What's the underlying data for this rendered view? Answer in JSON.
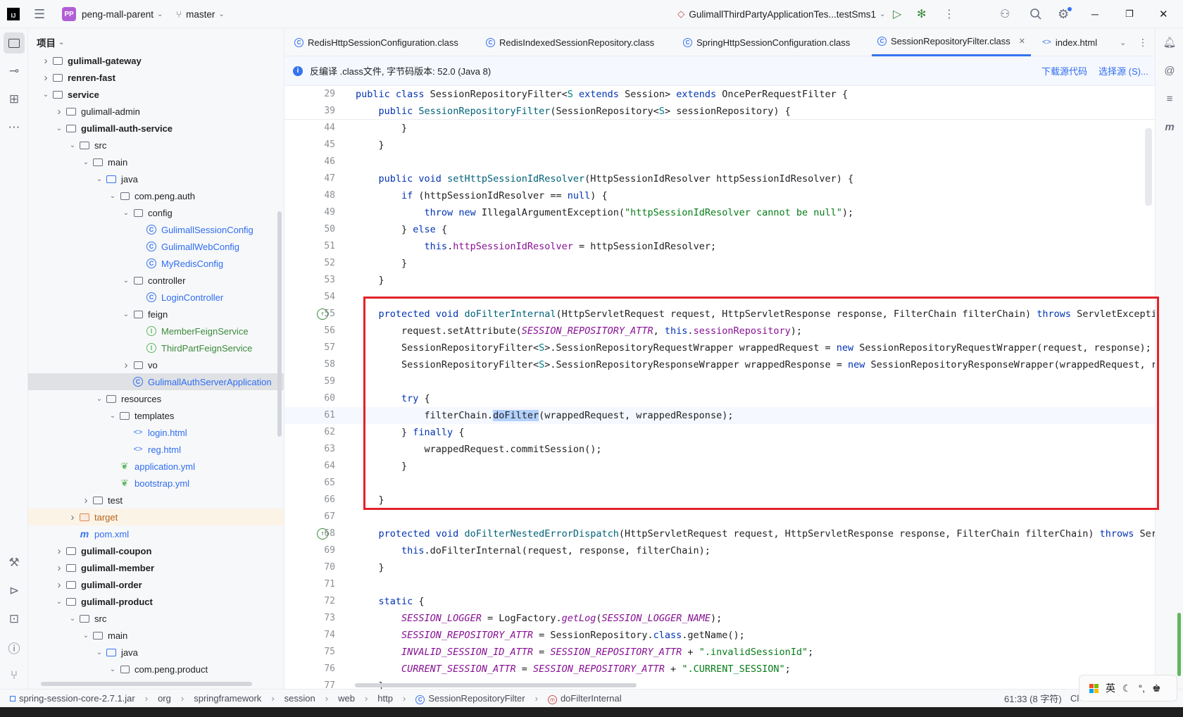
{
  "titlebar": {
    "project_badge": "PP",
    "project_name": "peng-mall-parent",
    "branch": "master",
    "run_config": "GulimallThirdPartyApplicationTes...testSms1"
  },
  "project_panel": {
    "title": "项目",
    "tree": [
      {
        "label": "gulimall-gateway",
        "indent": 1,
        "chev": "right",
        "icon": "module",
        "style": "bold"
      },
      {
        "label": "renren-fast",
        "indent": 1,
        "chev": "right",
        "icon": "module",
        "style": "bold"
      },
      {
        "label": "service",
        "indent": 1,
        "chev": "down",
        "icon": "module",
        "style": "bold"
      },
      {
        "label": "gulimall-admin",
        "indent": 2,
        "chev": "right",
        "icon": "module",
        "style": "normal"
      },
      {
        "label": "gulimall-auth-service",
        "indent": 2,
        "chev": "down",
        "icon": "module",
        "style": "bold"
      },
      {
        "label": "src",
        "indent": 3,
        "chev": "down",
        "icon": "folder",
        "style": "normal"
      },
      {
        "label": "main",
        "indent": 4,
        "chev": "down",
        "icon": "folder",
        "style": "normal"
      },
      {
        "label": "java",
        "indent": 5,
        "chev": "down",
        "icon": "folder-src",
        "style": "normal"
      },
      {
        "label": "com.peng.auth",
        "indent": 6,
        "chev": "down",
        "icon": "package",
        "style": "normal"
      },
      {
        "label": "config",
        "indent": 7,
        "chev": "down",
        "icon": "package",
        "style": "normal"
      },
      {
        "label": "GulimallSessionConfig",
        "indent": 8,
        "chev": "",
        "icon": "class",
        "style": "blue"
      },
      {
        "label": "GulimallWebConfig",
        "indent": 8,
        "chev": "",
        "icon": "class",
        "style": "blue"
      },
      {
        "label": "MyRedisConfig",
        "indent": 8,
        "chev": "",
        "icon": "class",
        "style": "blue"
      },
      {
        "label": "controller",
        "indent": 7,
        "chev": "down",
        "icon": "package",
        "style": "normal"
      },
      {
        "label": "LoginController",
        "indent": 8,
        "chev": "",
        "icon": "class",
        "style": "blue"
      },
      {
        "label": "feign",
        "indent": 7,
        "chev": "down",
        "icon": "package",
        "style": "normal"
      },
      {
        "label": "MemberFeignService",
        "indent": 8,
        "chev": "",
        "icon": "interface",
        "style": "green"
      },
      {
        "label": "ThirdPartFeignService",
        "indent": 8,
        "chev": "",
        "icon": "interface",
        "style": "green"
      },
      {
        "label": "vo",
        "indent": 7,
        "chev": "right",
        "icon": "package",
        "style": "normal"
      },
      {
        "label": "GulimallAuthServerApplication",
        "indent": 7,
        "chev": "",
        "icon": "class",
        "style": "blue",
        "selected": true
      },
      {
        "label": "resources",
        "indent": 5,
        "chev": "down",
        "icon": "folder",
        "style": "normal"
      },
      {
        "label": "templates",
        "indent": 6,
        "chev": "down",
        "icon": "folder",
        "style": "normal"
      },
      {
        "label": "login.html",
        "indent": 7,
        "chev": "",
        "icon": "html",
        "style": "blue"
      },
      {
        "label": "reg.html",
        "indent": 7,
        "chev": "",
        "icon": "html",
        "style": "blue"
      },
      {
        "label": "application.yml",
        "indent": 6,
        "chev": "",
        "icon": "yml",
        "style": "blue"
      },
      {
        "label": "bootstrap.yml",
        "indent": 6,
        "chev": "",
        "icon": "yml",
        "style": "blue"
      },
      {
        "label": "test",
        "indent": 4,
        "chev": "right",
        "icon": "folder",
        "style": "normal"
      },
      {
        "label": "target",
        "indent": 3,
        "chev": "right",
        "icon": "folder-orange",
        "style": "orange",
        "highlight": true
      },
      {
        "label": "pom.xml",
        "indent": 3,
        "chev": "",
        "icon": "maven",
        "style": "blue"
      },
      {
        "label": "gulimall-coupon",
        "indent": 2,
        "chev": "right",
        "icon": "module",
        "style": "bold"
      },
      {
        "label": "gulimall-member",
        "indent": 2,
        "chev": "right",
        "icon": "module",
        "style": "bold"
      },
      {
        "label": "gulimall-order",
        "indent": 2,
        "chev": "right",
        "icon": "module",
        "style": "bold"
      },
      {
        "label": "gulimall-product",
        "indent": 2,
        "chev": "down",
        "icon": "module",
        "style": "bold"
      },
      {
        "label": "src",
        "indent": 3,
        "chev": "down",
        "icon": "folder",
        "style": "normal"
      },
      {
        "label": "main",
        "indent": 4,
        "chev": "down",
        "icon": "folder",
        "style": "normal"
      },
      {
        "label": "java",
        "indent": 5,
        "chev": "down",
        "icon": "folder-src",
        "style": "normal"
      },
      {
        "label": "com.peng.product",
        "indent": 6,
        "chev": "down",
        "icon": "package",
        "style": "normal"
      }
    ]
  },
  "tabs": [
    {
      "label": "RedisHttpSessionConfiguration.class",
      "active": false
    },
    {
      "label": "RedisIndexedSessionRepository.class",
      "active": false
    },
    {
      "label": "SpringHttpSessionConfiguration.class",
      "active": false
    },
    {
      "label": "SessionRepositoryFilter.class",
      "active": true
    },
    {
      "label": "index.html",
      "active": false
    }
  ],
  "banner": {
    "text": "反编译 .class文件, 字节码版本: 52.0 (Java 8)",
    "download_link": "下载源代码",
    "choose_link": "选择源 (S)..."
  },
  "sticky_lines": [
    {
      "no": "29",
      "code": [
        [
          "kw",
          "public class "
        ],
        [
          "",
          "SessionRepositoryFilter<"
        ],
        [
          "tp",
          "S"
        ],
        [
          "",
          " "
        ],
        [
          "kw",
          "extends "
        ],
        [
          "",
          "Session> "
        ],
        [
          "kw",
          "extends "
        ],
        [
          "",
          "OncePerRequestFilter {"
        ]
      ]
    },
    {
      "no": "39",
      "code": [
        [
          "",
          "    "
        ],
        [
          "kw",
          "public "
        ],
        [
          "fn",
          "SessionRepositoryFilter"
        ],
        [
          "",
          "(SessionRepository<"
        ],
        [
          "tp",
          "S"
        ],
        [
          "",
          "> sessionRepository) {"
        ]
      ]
    }
  ],
  "code_lines": [
    {
      "no": "44",
      "code": [
        [
          "",
          "        }"
        ]
      ]
    },
    {
      "no": "45",
      "code": [
        [
          "",
          "    }"
        ]
      ]
    },
    {
      "no": "46",
      "code": []
    },
    {
      "no": "47",
      "code": [
        [
          "",
          "    "
        ],
        [
          "kw",
          "public void "
        ],
        [
          "fn",
          "setHttpSessionIdResolver"
        ],
        [
          "",
          "(HttpSessionIdResolver httpSessionIdResolver) {"
        ]
      ]
    },
    {
      "no": "48",
      "code": [
        [
          "",
          "        "
        ],
        [
          "kw",
          "if "
        ],
        [
          "",
          "(httpSessionIdResolver == "
        ],
        [
          "kw",
          "null"
        ],
        [
          "",
          ") {"
        ]
      ]
    },
    {
      "no": "49",
      "code": [
        [
          "",
          "            "
        ],
        [
          "kw",
          "throw new "
        ],
        [
          "",
          "IllegalArgumentException("
        ],
        [
          "str",
          "\"httpSessionIdResolver cannot be null\""
        ],
        [
          "",
          ");"
        ]
      ]
    },
    {
      "no": "50",
      "code": [
        [
          "",
          "        } "
        ],
        [
          "kw",
          "else "
        ],
        [
          "",
          "{"
        ]
      ]
    },
    {
      "no": "51",
      "code": [
        [
          "",
          "            "
        ],
        [
          "kw",
          "this"
        ],
        [
          "",
          "."
        ],
        [
          "fld",
          "httpSessionIdResolver"
        ],
        [
          "",
          " = httpSessionIdResolver;"
        ]
      ]
    },
    {
      "no": "52",
      "code": [
        [
          "",
          "        }"
        ]
      ]
    },
    {
      "no": "53",
      "code": [
        [
          "",
          "    }"
        ]
      ]
    },
    {
      "no": "54",
      "code": []
    },
    {
      "no": "55",
      "gutter": "override",
      "code": [
        [
          "",
          "    "
        ],
        [
          "kw",
          "protected void "
        ],
        [
          "fn",
          "doFilterInternal"
        ],
        [
          "",
          "(HttpServletRequest request, HttpServletResponse response, FilterChain filterChain) "
        ],
        [
          "kw",
          "throws "
        ],
        [
          "",
          "ServletException"
        ]
      ]
    },
    {
      "no": "56",
      "code": [
        [
          "",
          "        request.setAttribute("
        ],
        [
          "sfld",
          "SESSION_REPOSITORY_ATTR"
        ],
        [
          "",
          ", "
        ],
        [
          "kw",
          "this"
        ],
        [
          "",
          "."
        ],
        [
          "fld",
          "sessionRepository"
        ],
        [
          "",
          ");"
        ]
      ]
    },
    {
      "no": "57",
      "code": [
        [
          "",
          "        SessionRepositoryFilter<"
        ],
        [
          "tp",
          "S"
        ],
        [
          "",
          ">.SessionRepositoryRequestWrapper wrappedRequest = "
        ],
        [
          "kw",
          "new "
        ],
        [
          "",
          "SessionRepositoryRequestWrapper(request, response);"
        ]
      ]
    },
    {
      "no": "58",
      "code": [
        [
          "",
          "        SessionRepositoryFilter<"
        ],
        [
          "tp",
          "S"
        ],
        [
          "",
          ">.SessionRepositoryResponseWrapper wrappedResponse = "
        ],
        [
          "kw",
          "new "
        ],
        [
          "",
          "SessionRepositoryResponseWrapper(wrappedRequest, res"
        ]
      ]
    },
    {
      "no": "59",
      "code": []
    },
    {
      "no": "60",
      "code": [
        [
          "",
          "        "
        ],
        [
          "kw",
          "try "
        ],
        [
          "",
          "{"
        ]
      ]
    },
    {
      "no": "61",
      "current": true,
      "code": [
        [
          "",
          "            filterChain."
        ],
        [
          "hl",
          "doFilter"
        ],
        [
          "",
          "(wrappedRequest, wrappedResponse);"
        ]
      ]
    },
    {
      "no": "62",
      "code": [
        [
          "",
          "        } "
        ],
        [
          "kw",
          "finally "
        ],
        [
          "",
          "{"
        ]
      ]
    },
    {
      "no": "63",
      "code": [
        [
          "",
          "            wrappedRequest.commitSession();"
        ]
      ]
    },
    {
      "no": "64",
      "code": [
        [
          "",
          "        }"
        ]
      ]
    },
    {
      "no": "65",
      "code": []
    },
    {
      "no": "66",
      "code": [
        [
          "",
          "    }"
        ]
      ]
    },
    {
      "no": "67",
      "code": []
    },
    {
      "no": "68",
      "gutter": "override",
      "code": [
        [
          "",
          "    "
        ],
        [
          "kw",
          "protected void "
        ],
        [
          "fn",
          "doFilterNestedErrorDispatch"
        ],
        [
          "",
          "(HttpServletRequest request, HttpServletResponse response, FilterChain filterChain) "
        ],
        [
          "kw",
          "throws "
        ],
        [
          "",
          "Servl"
        ]
      ]
    },
    {
      "no": "69",
      "code": [
        [
          "",
          "        "
        ],
        [
          "kw",
          "this"
        ],
        [
          "",
          ".doFilterInternal(request, response, filterChain);"
        ]
      ]
    },
    {
      "no": "70",
      "code": [
        [
          "",
          "    }"
        ]
      ]
    },
    {
      "no": "71",
      "code": []
    },
    {
      "no": "72",
      "code": [
        [
          "",
          "    "
        ],
        [
          "kw",
          "static "
        ],
        [
          "",
          "{"
        ]
      ]
    },
    {
      "no": "73",
      "code": [
        [
          "",
          "        "
        ],
        [
          "sfld",
          "SESSION_LOGGER"
        ],
        [
          "",
          " = LogFactory."
        ],
        [
          "sfld",
          "getLog"
        ],
        [
          "",
          "("
        ],
        [
          "sfld",
          "SESSION_LOGGER_NAME"
        ],
        [
          "",
          ");"
        ]
      ]
    },
    {
      "no": "74",
      "code": [
        [
          "",
          "        "
        ],
        [
          "sfld",
          "SESSION_REPOSITORY_ATTR"
        ],
        [
          "",
          " = SessionRepository."
        ],
        [
          "kw",
          "class"
        ],
        [
          "",
          ".getName();"
        ]
      ]
    },
    {
      "no": "75",
      "code": [
        [
          "",
          "        "
        ],
        [
          "sfld",
          "INVALID_SESSION_ID_ATTR"
        ],
        [
          "",
          " = "
        ],
        [
          "sfld",
          "SESSION_REPOSITORY_ATTR"
        ],
        [
          "",
          " + "
        ],
        [
          "str",
          "\".invalidSessionId\""
        ],
        [
          "",
          ";"
        ]
      ]
    },
    {
      "no": "76",
      "code": [
        [
          "",
          "        "
        ],
        [
          "sfld",
          "CURRENT_SESSION_ATTR"
        ],
        [
          "",
          " = "
        ],
        [
          "sfld",
          "SESSION_REPOSITORY_ATTR"
        ],
        [
          "",
          " + "
        ],
        [
          "str",
          "\".CURRENT_SESSION\""
        ],
        [
          "",
          ";"
        ]
      ]
    },
    {
      "no": "77",
      "code": [
        [
          "",
          "    }"
        ]
      ]
    }
  ],
  "statusbar": {
    "crumbs": [
      "spring-session-core-2.7.1.jar",
      "org",
      "springframework",
      "session",
      "web",
      "http",
      "SessionRepositoryFilter",
      "doFilterInternal"
    ],
    "position": "61:33 (8 字符)",
    "extra": "Cl"
  },
  "ime": {
    "lang": "英"
  }
}
